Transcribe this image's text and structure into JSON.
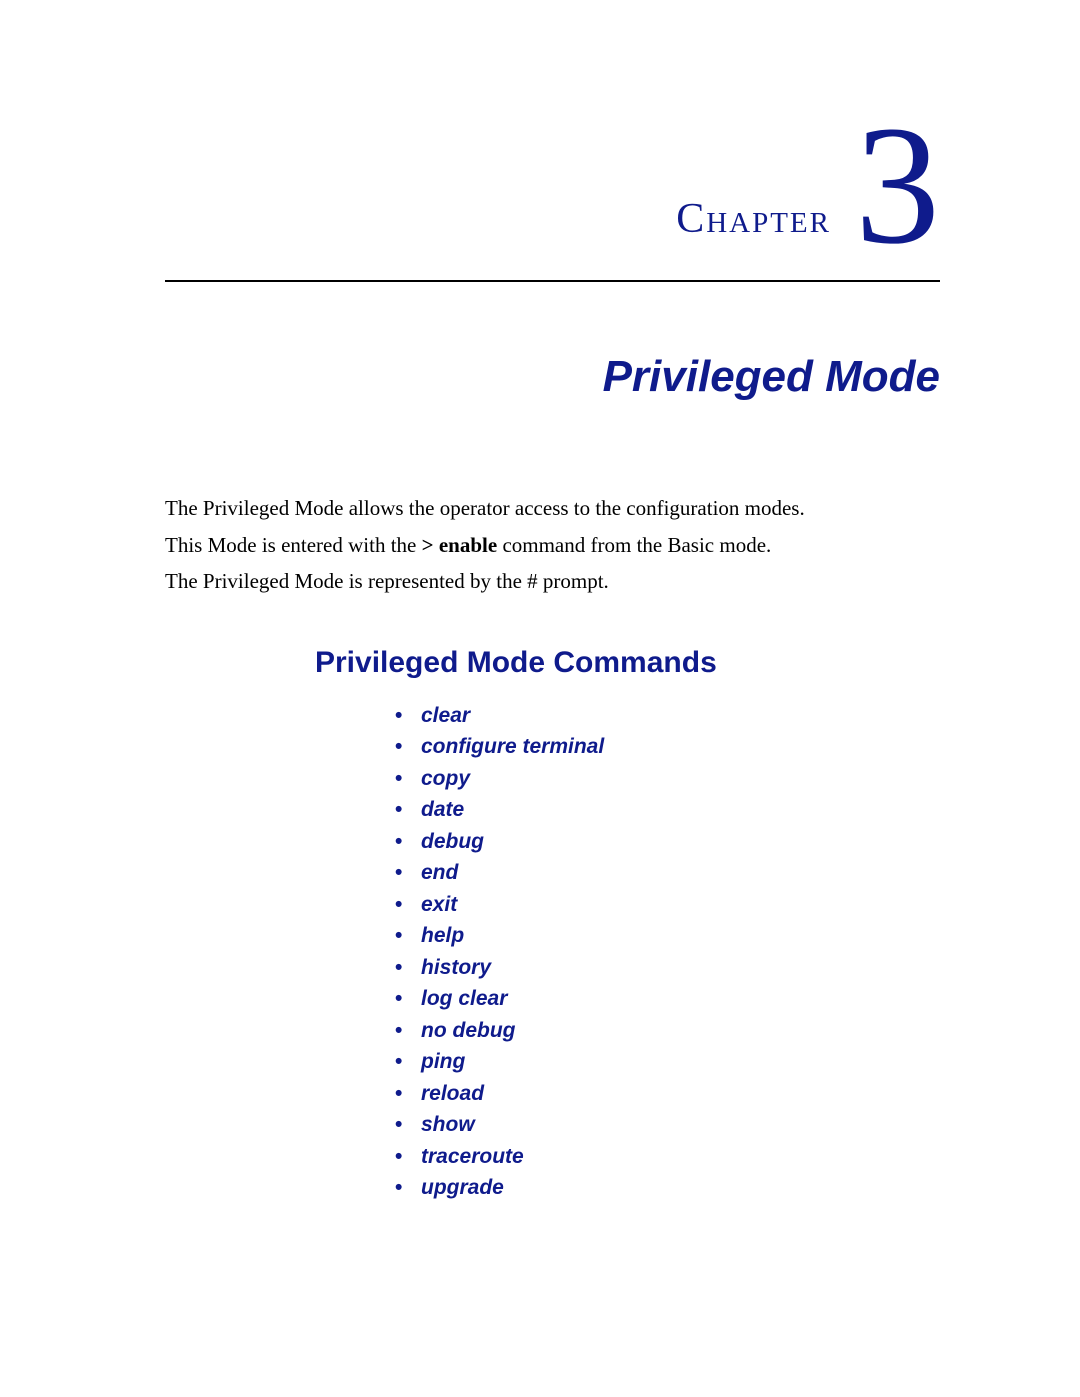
{
  "chapter": {
    "label": "Chapter",
    "number": "3",
    "title": "Privileged Mode"
  },
  "intro": {
    "p1": "The Privileged Mode allows the operator access to the configuration modes.",
    "p2_pre": "This Mode is entered with the ",
    "p2_cmd": "> enable",
    "p2_post": " command from the Basic mode.",
    "p3": "The Privileged Mode is represented by the # prompt."
  },
  "section": {
    "heading": "Privileged Mode Commands",
    "commands": [
      "clear",
      "configure terminal",
      "copy",
      "date",
      "debug",
      "end",
      "exit",
      "help",
      "history",
      "log clear",
      "no debug",
      "ping",
      "reload",
      "show",
      "traceroute",
      "upgrade"
    ]
  }
}
